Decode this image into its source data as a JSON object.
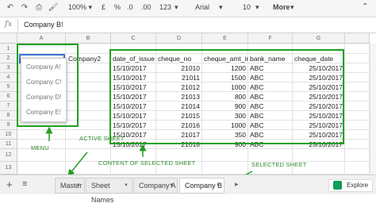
{
  "toolbar": {
    "currency": "£",
    "percent": "%",
    "decimal_less": ".0",
    "decimal_more": ".00",
    "number_format": "123",
    "font": "Arial",
    "font_size": "10",
    "more": "More"
  },
  "formula_bar": {
    "fx": "fx",
    "value": "Company B!"
  },
  "columns": [
    "A",
    "B",
    "C",
    "D",
    "E",
    "F",
    "G"
  ],
  "rows": [
    "1",
    "2",
    "3",
    "4",
    "5",
    "6",
    "7",
    "8",
    "9",
    "10",
    "11",
    "12",
    "13"
  ],
  "active_cell_value": "Company B!",
  "b2": "Company2",
  "headers": [
    "date_of_issue",
    "cheque_no",
    "cheque_amt_in",
    "bank_name",
    "cheque_date"
  ],
  "data_rows": [
    [
      "15/10/2017",
      "21010",
      "1200",
      "ABC",
      "25/10/2017"
    ],
    [
      "15/10/2017",
      "21011",
      "1500",
      "ABC",
      "25/10/2017"
    ],
    [
      "15/10/2017",
      "21012",
      "1000",
      "ABC",
      "25/10/2017"
    ],
    [
      "15/10/2017",
      "21013",
      "800",
      "ABC",
      "25/10/2017"
    ],
    [
      "15/10/2017",
      "21014",
      "900",
      "ABC",
      "25/10/2017"
    ],
    [
      "15/10/2017",
      "21015",
      "300",
      "ABC",
      "25/10/2017"
    ],
    [
      "15/10/2017",
      "21016",
      "1000",
      "ABC",
      "25/10/2017"
    ],
    [
      "15/10/2017",
      "21017",
      "350",
      "ABC",
      "25/10/2017"
    ],
    [
      "15/10/2017",
      "21018",
      "900",
      "ABC",
      "25/10/2017"
    ]
  ],
  "dropdown_items": [
    "Company A!",
    "Company C!",
    "Company D!",
    "Company E!"
  ],
  "annotations": {
    "menu": "MENU",
    "active_sheet": "ACTIVE SHEET",
    "content": "CONTENT OF SELECTED SHEET",
    "selected_sheet": "SELECTED SHEET"
  },
  "tabs": [
    "Master",
    "Sheet Names",
    "Company A",
    "Company B"
  ],
  "explore": "Explore",
  "colors": {
    "annotation_green": "#22a022",
    "explore_green": "#0f9d58"
  }
}
